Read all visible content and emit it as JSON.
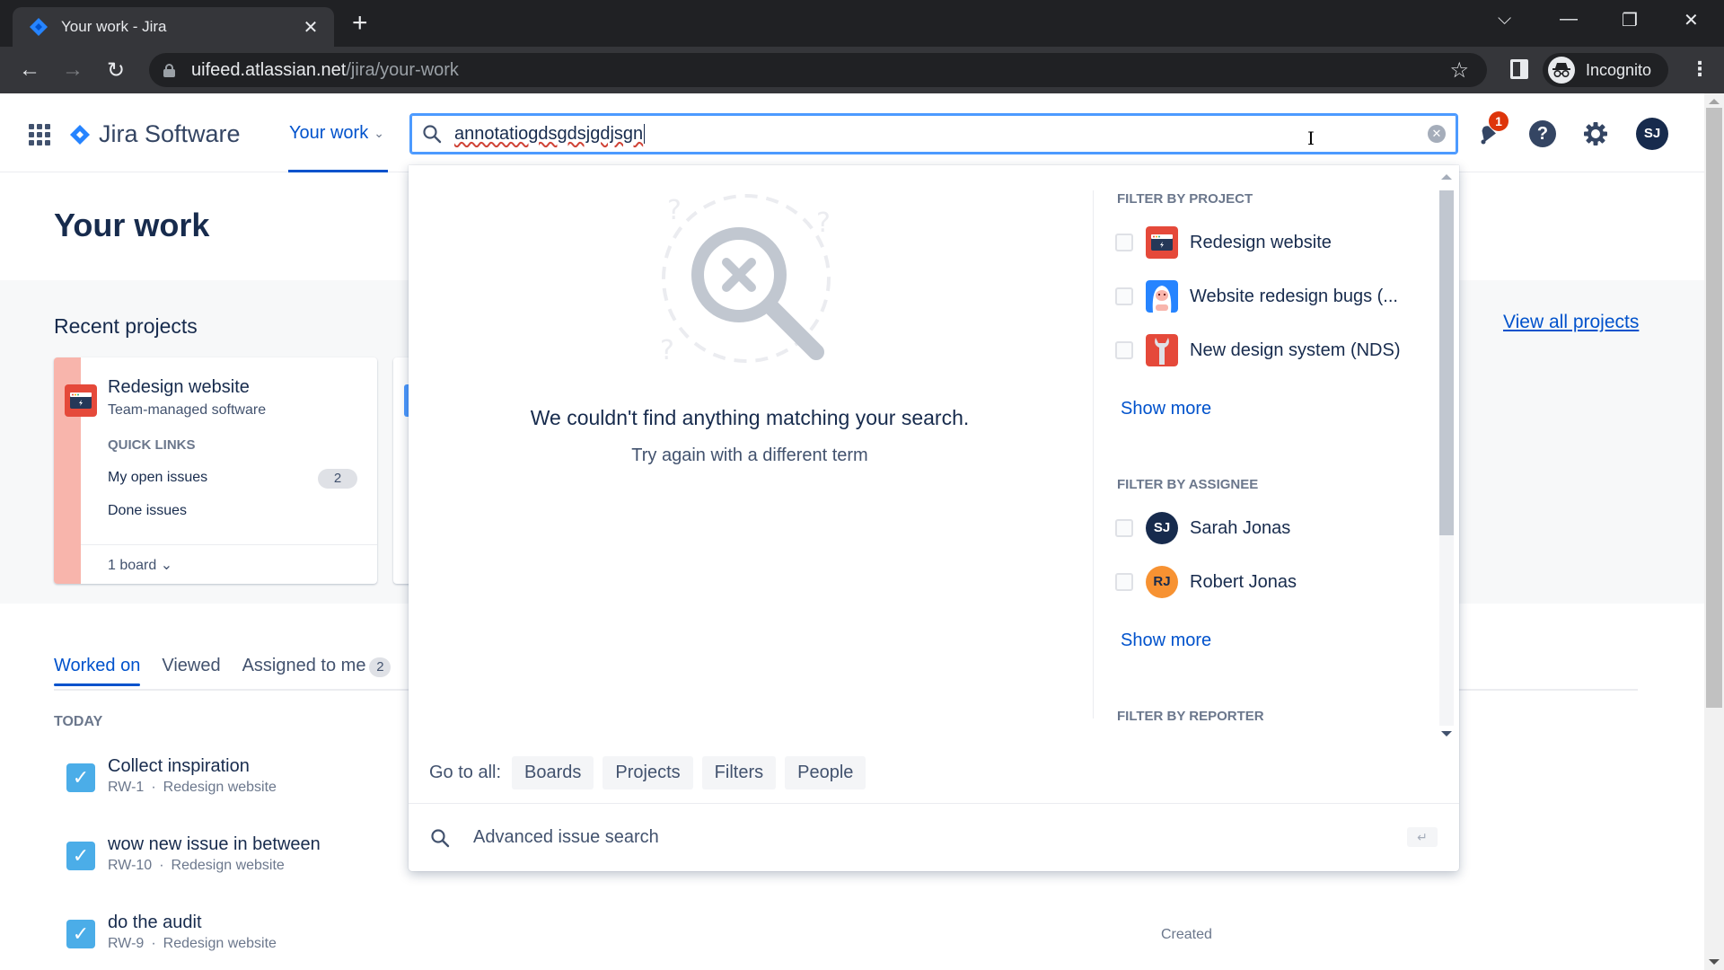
{
  "browser": {
    "tab_title": "Your work - Jira",
    "new_tab": "+",
    "close_tab": "✕",
    "url_host": "uifeed.atlassian.net",
    "url_path": "/jira/your-work",
    "profile_label": "Incognito",
    "icons": {
      "back": "←",
      "forward": "→",
      "reload": "↻",
      "bookmark": "☆",
      "menu": "⋮",
      "tab_search": "⌵",
      "minimize": "—",
      "restore": "❐",
      "close": "✕"
    }
  },
  "jira_nav": {
    "product_name": "Jira Software",
    "your_work": "Your work",
    "chevron": "⌄",
    "search": {
      "value": "annotatiogdsgdsjgdjsgn",
      "clear": "✕"
    },
    "notifications_count": "1",
    "help": "?",
    "user_initials": "SJ"
  },
  "page": {
    "title": "Your work",
    "recent_projects_title": "Recent projects",
    "view_all_projects": "View all projects",
    "project_card": {
      "name": "Redesign website",
      "type": "Team-managed software",
      "quick_links_label": "QUICK LINKS",
      "links": [
        {
          "label": "My open issues",
          "count": "2"
        },
        {
          "label": "Done issues"
        }
      ],
      "boards": "1 board ⌄"
    },
    "tabs": [
      {
        "label": "Worked on",
        "active": true
      },
      {
        "label": "Viewed"
      },
      {
        "label": "Assigned to me",
        "count": "2"
      }
    ],
    "section_label": "TODAY",
    "issues": [
      {
        "title": "Collect inspiration",
        "key": "RW-1",
        "project": "Redesign website"
      },
      {
        "title": "wow new issue in between",
        "key": "RW-10",
        "project": "Redesign website"
      },
      {
        "title": "do the audit",
        "key": "RW-9",
        "project": "Redesign website"
      }
    ],
    "meta_separator": "·",
    "created_label": "Created"
  },
  "search_dropdown": {
    "empty_heading": "We couldn't find anything matching your search.",
    "empty_sub": "Try again with a different term",
    "filter_by_project": {
      "heading": "FILTER BY PROJECT",
      "items": [
        {
          "label": "Redesign website",
          "icon": "browser-window-icon",
          "color": "#e5493a"
        },
        {
          "label": "Website redesign bugs (...",
          "icon": "yeti-icon",
          "color": "#2684ff"
        },
        {
          "label": "New design system (NDS)",
          "icon": "wrench-icon",
          "color": "#e5493a"
        }
      ],
      "show_more": "Show more"
    },
    "filter_by_assignee": {
      "heading": "FILTER BY ASSIGNEE",
      "items": [
        {
          "label": "Sarah Jonas",
          "initials": "SJ",
          "color": "#172b4d"
        },
        {
          "label": "Robert Jonas",
          "initials": "RJ",
          "color": "#f79232"
        }
      ],
      "show_more": "Show more"
    },
    "filter_by_reporter": {
      "heading": "FILTER BY REPORTER"
    },
    "go_to_all_label": "Go to all:",
    "go_to_all": [
      "Boards",
      "Projects",
      "Filters",
      "People"
    ],
    "advanced_search": "Advanced issue search",
    "enter_key": "↵"
  },
  "colors": {
    "brand_blue": "#0052cc",
    "focus_ring": "#4c9aff",
    "badge_red": "#de350b",
    "issue_check": "#4bade8"
  }
}
